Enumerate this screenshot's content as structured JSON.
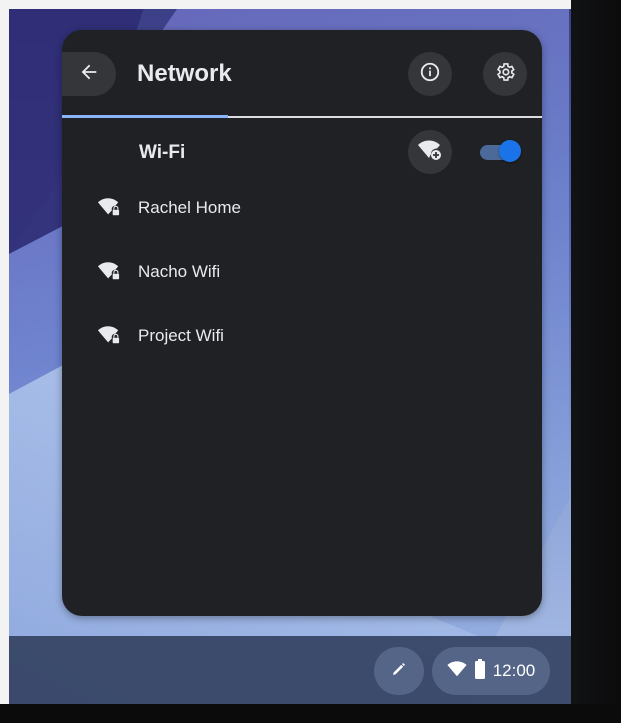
{
  "panel": {
    "title": "Network",
    "section_label": "Wi-Fi",
    "wifi_enabled": true,
    "networks": [
      {
        "name": "Rachel Home",
        "icon": "wifi-locked-icon"
      },
      {
        "name": "Nacho Wifi",
        "icon": "wifi-locked-icon"
      },
      {
        "name": "Project Wifi",
        "icon": "wifi-locked-icon"
      }
    ]
  },
  "shelf": {
    "time": "12:00",
    "stylus_icon": "stylus-icon",
    "status_icons": [
      "wifi-icon",
      "battery-icon"
    ]
  },
  "colors": {
    "panel_bg": "#202124",
    "button_bg": "#35363a",
    "accent": "#1a73e8",
    "accent_light": "#8ab4f8",
    "text": "#e8eaed"
  }
}
